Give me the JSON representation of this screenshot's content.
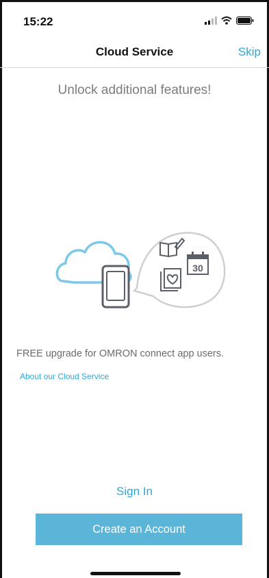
{
  "status_bar": {
    "time": "15:22",
    "icons": [
      "signal-icon",
      "wifi-icon",
      "battery-icon"
    ]
  },
  "nav": {
    "title": "Cloud Service",
    "skip_label": "Skip"
  },
  "main": {
    "headline": "Unlock additional features!",
    "calendar_day": "30",
    "upgrade_text": "FREE upgrade for OMRON connect app users.",
    "about_link": "About our Cloud Service"
  },
  "actions": {
    "sign_in_label": "Sign In",
    "create_account_label": "Create an Account"
  },
  "colors": {
    "accent": "#2aa8d8",
    "button": "#5ab5d8",
    "cloud": "#7cc8e8",
    "icon_gray": "#5a5f6a"
  }
}
